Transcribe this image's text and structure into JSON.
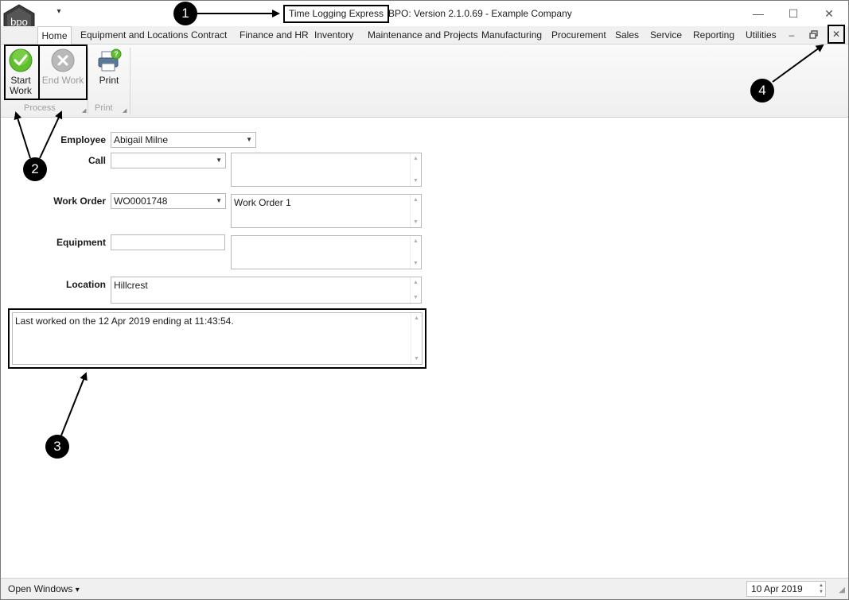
{
  "window": {
    "title_highlight": "Time Logging Express",
    "title_rest": "BPO: Version 2.1.0.69 - Example Company",
    "logo_text": "bpo",
    "qat_glyph": "▾",
    "minimize": "—",
    "maximize": "☐",
    "close": "✕"
  },
  "tabs": [
    {
      "label": "Home",
      "active": true
    },
    {
      "label": "Equipment and Locations"
    },
    {
      "label": "Contract"
    },
    {
      "label": "Finance and HR"
    },
    {
      "label": "Inventory"
    },
    {
      "label": "Maintenance and Projects"
    },
    {
      "label": "Manufacturing"
    },
    {
      "label": "Procurement"
    },
    {
      "label": "Sales"
    },
    {
      "label": "Service"
    },
    {
      "label": "Reporting"
    },
    {
      "label": "Utilities"
    }
  ],
  "mdi": {
    "minimize": "–",
    "restore": "🗗",
    "close": "✕"
  },
  "ribbon": {
    "start_work": "Start Work",
    "start_work_line1": "Start",
    "start_work_line2": "Work",
    "end_work": "End Work",
    "print": "Print",
    "group_process": "Process",
    "group_print": "Print",
    "launcher": "◢"
  },
  "form": {
    "employee_label": "Employee",
    "employee_value": "Abigail Milne",
    "call_label": "Call",
    "call_value": "",
    "call_desc": "",
    "work_order_label": "Work Order",
    "work_order_value": "WO0001748",
    "work_order_desc": "Work Order 1",
    "equipment_label": "Equipment",
    "equipment_value": "",
    "equipment_desc": "",
    "location_label": "Location",
    "location_value": "Hillcrest",
    "message": "Last worked on the 12 Apr 2019 ending at 11:43:54."
  },
  "callouts": [
    "1",
    "2",
    "3",
    "4"
  ],
  "statusbar": {
    "open_windows": "Open Windows",
    "open_windows_arrow": "▾",
    "date": "10 Apr 2019",
    "grip": "◢"
  },
  "colors": {
    "start_icon": "#5fbf2f",
    "end_icon": "#b9b9b9",
    "callout_bg": "#000000"
  }
}
